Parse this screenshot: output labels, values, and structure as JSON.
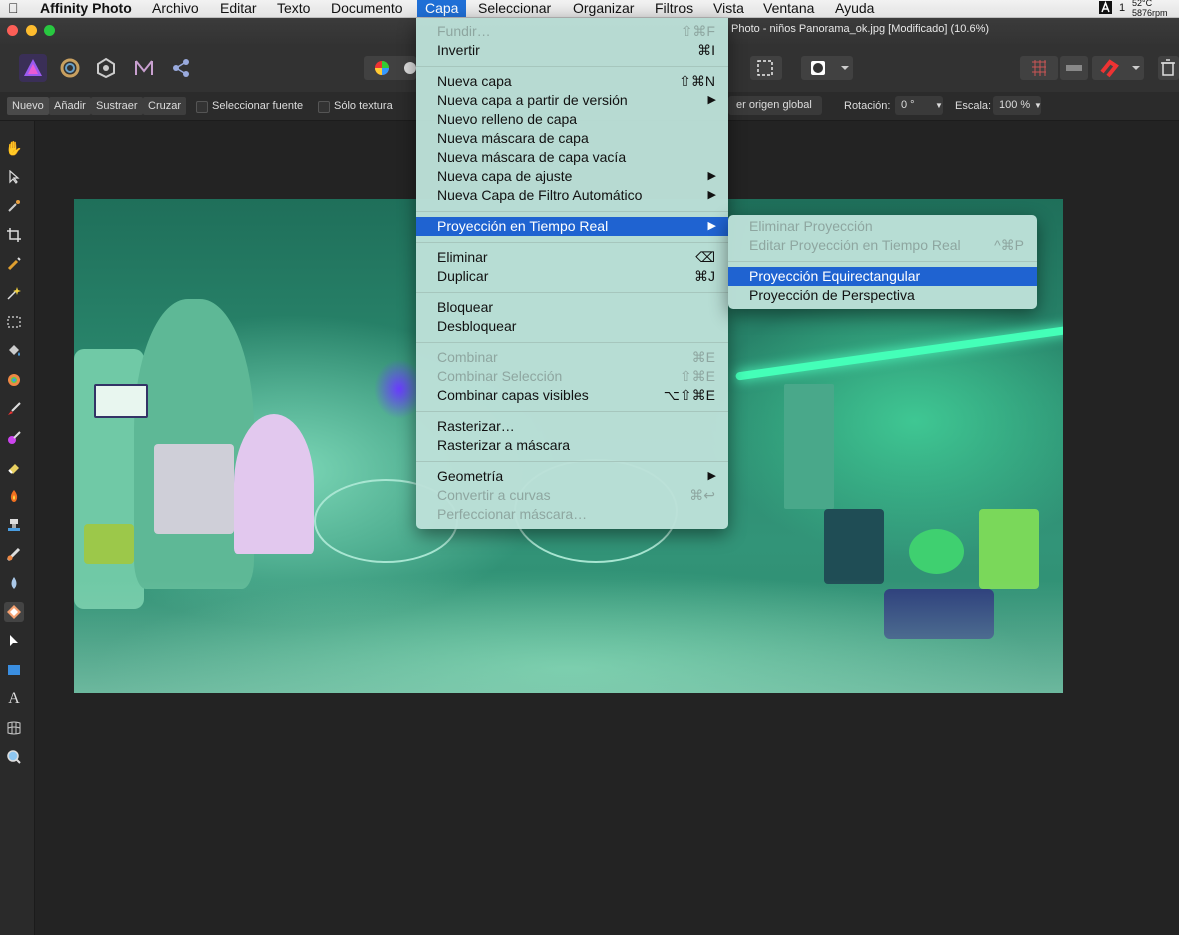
{
  "menubar": {
    "apple_icon": "apple-logo",
    "app_name": "Affinity Photo",
    "items": [
      "Archivo",
      "Editar",
      "Texto",
      "Documento",
      "Capa",
      "Seleccionar",
      "Organizar",
      "Filtros",
      "Vista",
      "Ventana",
      "Ayuda"
    ],
    "active": "Capa",
    "status": {
      "temperature": "52°C",
      "fan": "5876rpm",
      "badge": "1"
    }
  },
  "window": {
    "title": "Photo - niños Panorama_ok.jpg [Modificado] (10.6%)"
  },
  "context_toolbar": {
    "mode_buttons": [
      "Nuevo",
      "Añadir",
      "Sustraer",
      "Cruzar"
    ],
    "sample_source_label": "Seleccionar fuente",
    "texture_only_label": "Sólo textura",
    "global_origin_label": "er origen global",
    "rotation_label": "Rotación:",
    "rotation_value": "0 °",
    "scale_label": "Escala:",
    "scale_value": "100 %"
  },
  "capa_menu": {
    "items": [
      {
        "label": "Fundir…",
        "shortcut": "⇧⌘F",
        "enabled": false
      },
      {
        "label": "Invertir",
        "shortcut": "⌘I",
        "enabled": true
      },
      {
        "label": "Nueva capa",
        "shortcut": "⇧⌘N",
        "enabled": true
      },
      {
        "label": "Nueva capa a partir de versión",
        "submenu": true,
        "enabled": true
      },
      {
        "label": "Nuevo relleno de capa",
        "enabled": true
      },
      {
        "label": "Nueva máscara de capa",
        "enabled": true
      },
      {
        "label": "Nueva máscara de capa vacía",
        "enabled": true
      },
      {
        "label": "Nueva capa de ajuste",
        "submenu": true,
        "enabled": true
      },
      {
        "label": "Nueva Capa de Filtro Automático",
        "submenu": true,
        "enabled": true
      },
      {
        "label": "Proyección en Tiempo Real",
        "submenu": true,
        "enabled": true,
        "highlighted": true
      },
      {
        "label": "Eliminar",
        "shortcut": "⌫",
        "enabled": true
      },
      {
        "label": "Duplicar",
        "shortcut": "⌘J",
        "enabled": true
      },
      {
        "label": "Bloquear",
        "enabled": true
      },
      {
        "label": "Desbloquear",
        "enabled": true
      },
      {
        "label": "Combinar",
        "shortcut": "⌘E",
        "enabled": false
      },
      {
        "label": "Combinar Selección",
        "shortcut": "⇧⌘E",
        "enabled": false
      },
      {
        "label": "Combinar capas visibles",
        "shortcut": "⌥⇧⌘E",
        "enabled": true
      },
      {
        "label": "Rasterizar…",
        "enabled": true
      },
      {
        "label": "Rasterizar a máscara",
        "enabled": true
      },
      {
        "label": "Geometría",
        "submenu": true,
        "enabled": true
      },
      {
        "label": "Convertir a curvas",
        "shortcut": "⌘↩",
        "enabled": false
      },
      {
        "label": "Perfeccionar máscara…",
        "enabled": false
      }
    ],
    "submenu_arrow": "▶"
  },
  "projection_submenu": {
    "items": [
      {
        "label": "Eliminar Proyección",
        "enabled": false
      },
      {
        "label": "Editar Proyección en Tiempo Real",
        "shortcut": "^⌘P",
        "enabled": false
      },
      {
        "label": "Proyección Equirectangular",
        "enabled": true,
        "highlighted": true
      },
      {
        "label": "Proyección de Perspectiva",
        "enabled": true
      }
    ]
  },
  "colors": {
    "menu_bg": "#bce0d8",
    "highlight": "#1f63d1",
    "accent_app": "#6a3fc6"
  }
}
